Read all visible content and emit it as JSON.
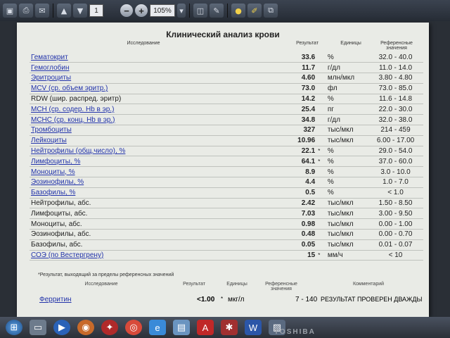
{
  "toolbar": {
    "page_number": "1",
    "zoom": "105%"
  },
  "document": {
    "title": "Клинический анализ крови",
    "headers": {
      "study": "Исследование",
      "result": "Результат",
      "units": "Единицы",
      "reference": "Референсные значения"
    },
    "rows": [
      {
        "name": "Гематокрит",
        "link": true,
        "value": "33.6",
        "flag": "",
        "unit": "%",
        "ref": "32.0 - 40.0"
      },
      {
        "name": "Гемоглобин",
        "link": true,
        "value": "11.7",
        "flag": "",
        "unit": "г/дл",
        "ref": "11.0 - 14.0"
      },
      {
        "name": "Эритроциты",
        "link": true,
        "value": "4.60",
        "flag": "",
        "unit": "млн/мкл",
        "ref": "3.80 - 4.80"
      },
      {
        "name": "MCV (ср. объем эритр.)",
        "link": true,
        "value": "73.0",
        "flag": "",
        "unit": "фл",
        "ref": "73.0 - 85.0"
      },
      {
        "name": "RDW (шир. распред. эритр)",
        "link": false,
        "value": "14.2",
        "flag": "",
        "unit": "%",
        "ref": "11.6 - 14.8"
      },
      {
        "name": "MCH (ср. содер. Hb в эр.)",
        "link": true,
        "value": "25.4",
        "flag": "",
        "unit": "пг",
        "ref": "22.0 - 30.0"
      },
      {
        "name": "MCHC (ср. конц. Hb в эр.)",
        "link": true,
        "value": "34.8",
        "flag": "",
        "unit": "г/дл",
        "ref": "32.0 - 38.0"
      },
      {
        "name": "Тромбоциты",
        "link": true,
        "value": "327",
        "flag": "",
        "unit": "тыс/мкл",
        "ref": "214 - 459"
      },
      {
        "name": "Лейкоциты",
        "link": true,
        "value": "10.96",
        "flag": "",
        "unit": "тыс/мкл",
        "ref": "6.00 - 17.00"
      },
      {
        "name": "Нейтрофилы (общ.число), %",
        "link": true,
        "value": "22.1",
        "flag": "*",
        "unit": "%",
        "ref": "29.0 - 54.0"
      },
      {
        "name": "Лимфоциты, %",
        "link": true,
        "value": "64.1",
        "flag": "*",
        "unit": "%",
        "ref": "37.0 - 60.0"
      },
      {
        "name": "Моноциты, %",
        "link": true,
        "value": "8.9",
        "flag": "",
        "unit": "%",
        "ref": "3.0 - 10.0"
      },
      {
        "name": "Эозинофилы, %",
        "link": true,
        "value": "4.4",
        "flag": "",
        "unit": "%",
        "ref": "1.0 - 7.0"
      },
      {
        "name": "Базофилы, %",
        "link": true,
        "value": "0.5",
        "flag": "",
        "unit": "%",
        "ref": "< 1.0"
      },
      {
        "name": "Нейтрофилы, абс.",
        "link": false,
        "value": "2.42",
        "flag": "",
        "unit": "тыс/мкл",
        "ref": "1.50 - 8.50"
      },
      {
        "name": "Лимфоциты, абс.",
        "link": false,
        "value": "7.03",
        "flag": "",
        "unit": "тыс/мкл",
        "ref": "3.00 - 9.50"
      },
      {
        "name": "Моноциты, абс.",
        "link": false,
        "value": "0.98",
        "flag": "",
        "unit": "тыс/мкл",
        "ref": "0.00 - 1.00"
      },
      {
        "name": "Эозинофилы, абс.",
        "link": false,
        "value": "0.48",
        "flag": "",
        "unit": "тыс/мкл",
        "ref": "0.00 - 0.70"
      },
      {
        "name": "Базофилы, абс.",
        "link": false,
        "value": "0.05",
        "flag": "",
        "unit": "тыс/мкл",
        "ref": "0.01 - 0.07"
      },
      {
        "name": "СОЭ (по Вестергрену)",
        "link": true,
        "value": "15",
        "flag": "*",
        "unit": "мм/ч",
        "ref": "< 10"
      }
    ],
    "footnote": "*Результат, выходящий за пределы референсных значений",
    "sub_headers": {
      "study": "Исследование",
      "result": "Результат",
      "units": "Единицы",
      "reference": "Референсные значения",
      "comment": "Комментарий"
    },
    "last_row": {
      "name": "Ферритин",
      "value": "<1.00",
      "flag": "*",
      "unit": "мкг/л",
      "ref": "7 - 140",
      "comment": "РЕЗУЛЬТАТ ПРОВЕРЕН ДВАЖДЫ"
    }
  },
  "taskbar_brand": "TOSHIBA",
  "icons": {
    "toolbar": [
      "save-icon",
      "print-icon",
      "mail-icon",
      "page-up-icon",
      "page-down-icon",
      "zoom-out-icon",
      "zoom-in-icon",
      "fit-page-icon",
      "tools-icon",
      "comment-icon",
      "sign-icon"
    ],
    "taskbar": [
      "start-icon",
      "explorer-icon",
      "media-player-icon",
      "firefox-icon",
      "pinned-icon",
      "chrome-icon",
      "ie-icon",
      "folder-icon",
      "pdf-icon",
      "app-icon",
      "word-icon",
      "paint-icon"
    ]
  }
}
